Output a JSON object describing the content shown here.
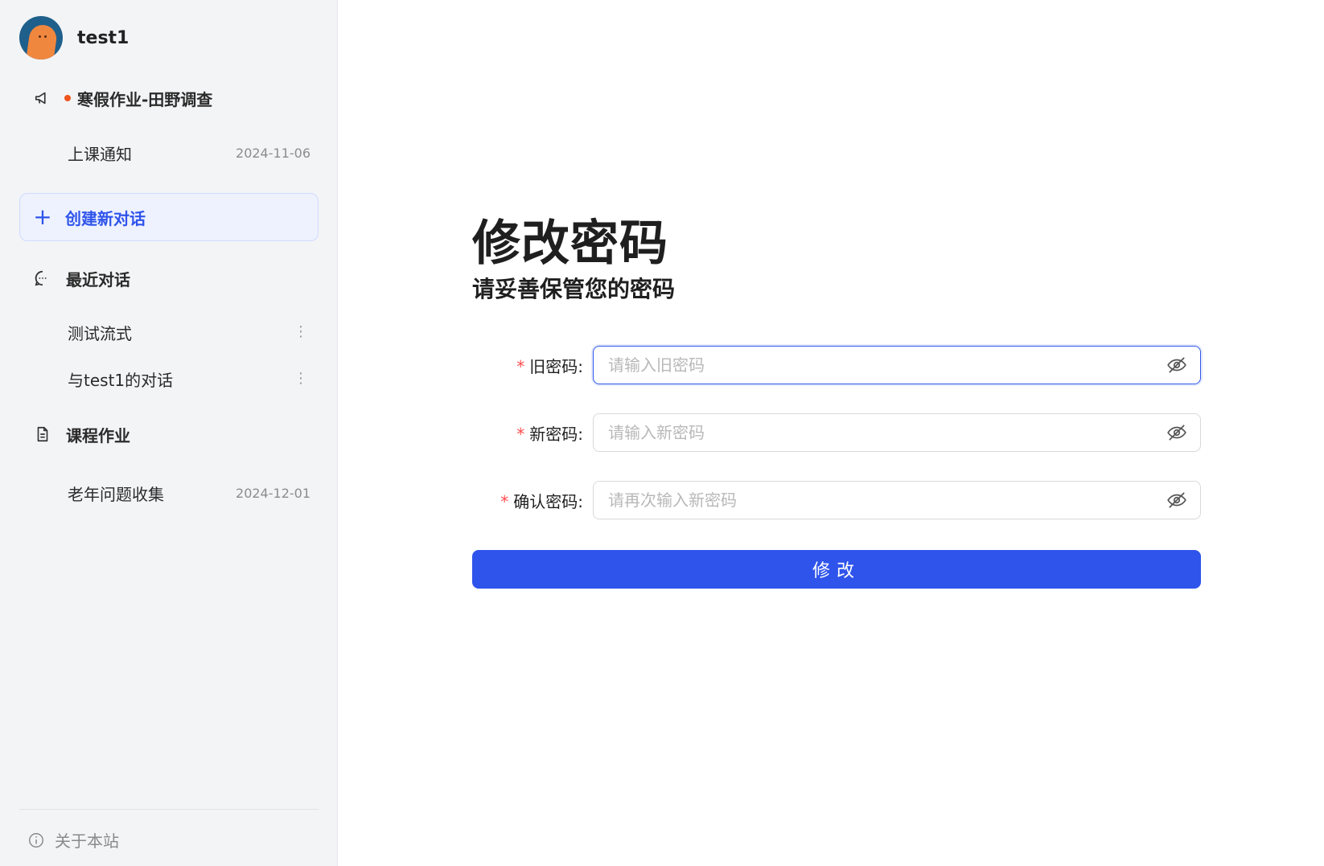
{
  "user": {
    "name": "test1"
  },
  "sidebar": {
    "announcements": {
      "icon": "megaphone-icon",
      "title": "寒假作业-田野调查",
      "items": [
        {
          "label": "上课通知",
          "date": "2024-11-06"
        }
      ]
    },
    "new_chat_label": "创建新对话",
    "recent": {
      "icon": "chat-bubble-icon",
      "title": "最近对话",
      "items": [
        {
          "label": "测试流式"
        },
        {
          "label": "与test1的对话"
        }
      ]
    },
    "homework": {
      "icon": "document-icon",
      "title": "课程作业",
      "items": [
        {
          "label": "老年问题收集",
          "date": "2024-12-01"
        }
      ]
    },
    "about_label": "关于本站"
  },
  "main": {
    "title": "修改密码",
    "subtitle": "请妥善保管您的密码",
    "fields": [
      {
        "label": "旧密码",
        "required_mark": "*",
        "colon": ":",
        "placeholder": "请输入旧密码",
        "value": ""
      },
      {
        "label": "新密码",
        "required_mark": "*",
        "colon": ":",
        "placeholder": "请输入新密码",
        "value": ""
      },
      {
        "label": "确认密码",
        "required_mark": "*",
        "colon": ":",
        "placeholder": "请再次输入新密码",
        "value": ""
      }
    ],
    "submit_label": "修改"
  },
  "colors": {
    "accent": "#2f54eb",
    "required": "#ff4d4f",
    "notification_dot": "#f0541e",
    "sidebar_bg": "#f3f4f6"
  }
}
